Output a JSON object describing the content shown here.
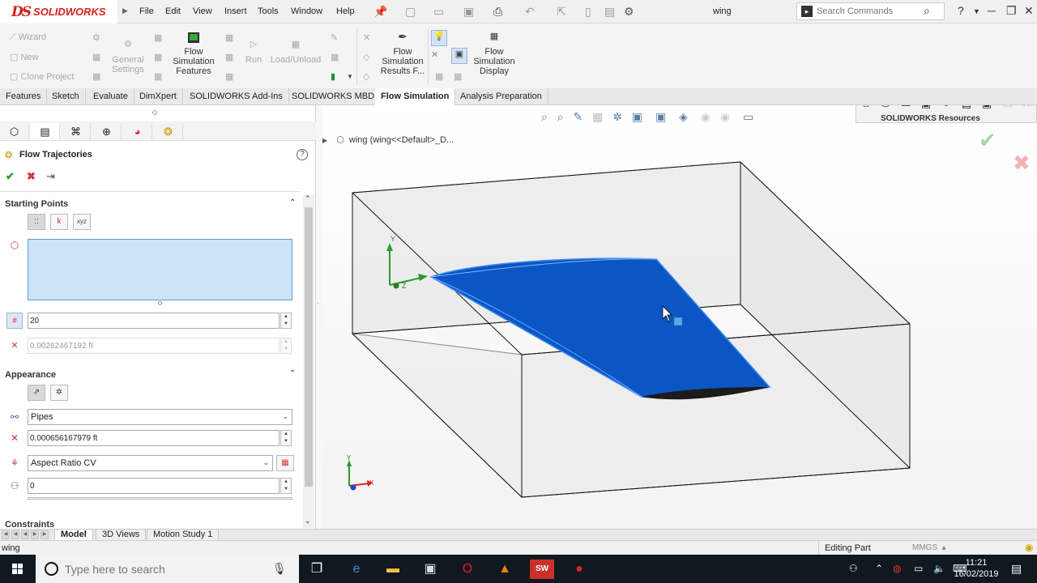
{
  "app": {
    "brand_ds": "DS",
    "brand_name": "SOLIDWORKS",
    "doc_title": "wing"
  },
  "menu": [
    "File",
    "Edit",
    "View",
    "Insert",
    "Tools",
    "Window",
    "Help"
  ],
  "search": {
    "placeholder": "Search Commands"
  },
  "command_manager": {
    "left_small": [
      "Wizard",
      "New",
      "Clone Project"
    ],
    "general_settings": "General Settings",
    "flow_sim_features": "Flow Simulation Features",
    "run": "Run",
    "load_unload": "Load/Unload",
    "results_features": "Flow Simulation Results F...",
    "display": "Flow Simulation Display"
  },
  "tabs": [
    "Features",
    "Sketch",
    "Evaluate",
    "DimXpert",
    "SOLIDWORKS Add-Ins",
    "SOLIDWORKS MBD",
    "Flow Simulation",
    "Analysis Preparation"
  ],
  "active_tab": "Flow Simulation",
  "property_manager": {
    "title": "Flow Trajectories",
    "help": "?",
    "starting_points": {
      "header": "Starting Points",
      "buttons": [
        "::",
        "k",
        "xyz"
      ],
      "number_of_points": "20",
      "offset": "0.00262467192 ft"
    },
    "appearance": {
      "header": "Appearance",
      "draw_as": "Pipes",
      "width": "0.000656167979 ft",
      "color_by": "Aspect Ratio CV",
      "value": "0"
    },
    "constraints_header": "Constraints"
  },
  "graphics": {
    "tree_node": "wing  (wing<<Default>_D...",
    "resources_title": "SOLIDWORKS Resources",
    "triad": {
      "x": "X",
      "y": "Y",
      "z": "Z"
    }
  },
  "bottom_tabs": [
    "Model",
    "3D Views",
    "Motion Study 1"
  ],
  "active_bottom_tab": "Model",
  "status": {
    "left": "wing",
    "editing": "Editing Part",
    "units": "MMGS"
  },
  "taskbar": {
    "search_placeholder": "Type here to search",
    "time": "11:21",
    "date": "16/02/2019"
  },
  "colors": {
    "wing_blue": "#0a56c4",
    "brand_red": "#d6201b",
    "selection_box": "#cce4f7",
    "taskbar": "#101820"
  }
}
